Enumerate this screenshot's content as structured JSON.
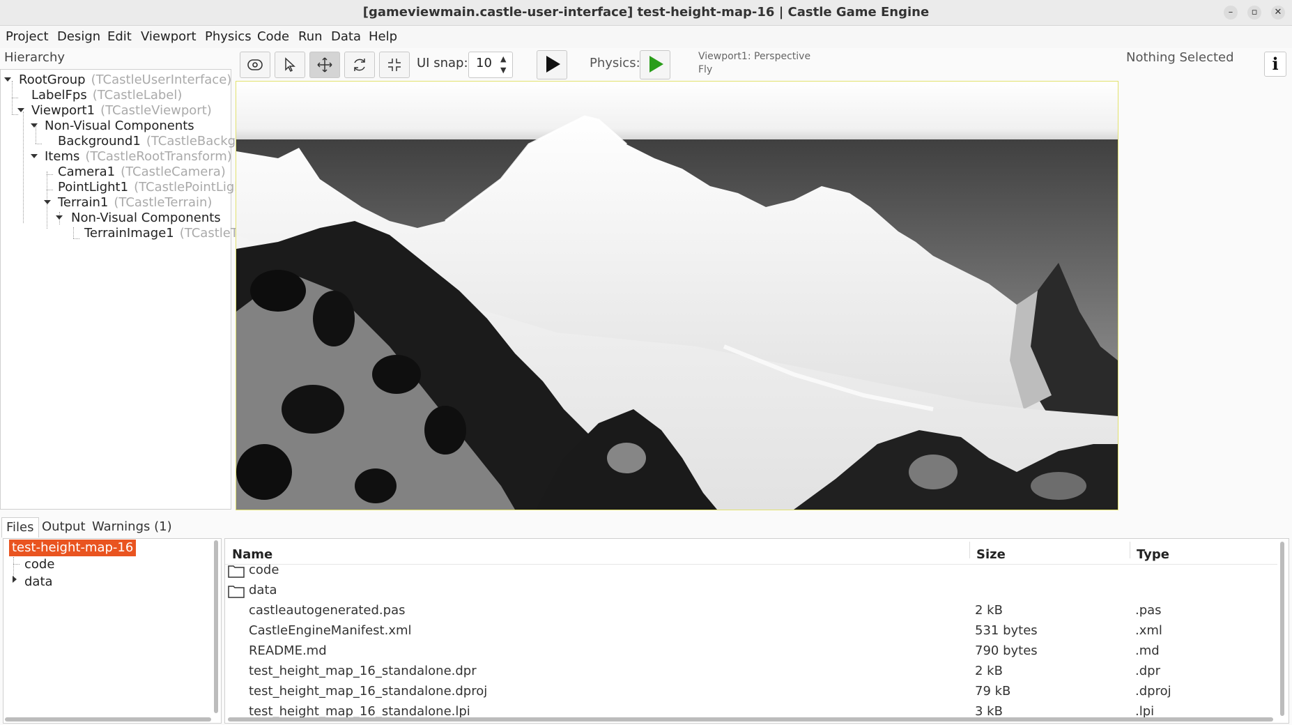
{
  "window": {
    "title": "[gameviewmain.castle-user-interface] test-height-map-16 | Castle Game Engine",
    "controls": [
      "minimize-icon",
      "maximize-icon",
      "close-icon"
    ]
  },
  "menu": [
    "Project",
    "Design",
    "Edit",
    "Viewport",
    "Physics",
    "Code",
    "Run",
    "Data",
    "Help"
  ],
  "hierarchy": {
    "label": "Hierarchy",
    "nodes": [
      {
        "name": "RootGroup",
        "class": "(TCastleUserInterface)"
      },
      {
        "name": "LabelFps",
        "class": "(TCastleLabel)"
      },
      {
        "name": "Viewport1",
        "class": "(TCastleViewport)"
      },
      {
        "name": "Non-Visual Components",
        "class": ""
      },
      {
        "name": "Background1",
        "class": "(TCastleBackgro"
      },
      {
        "name": "Items",
        "class": "(TCastleRootTransform)"
      },
      {
        "name": "Camera1",
        "class": "(TCastleCamera)"
      },
      {
        "name": "PointLight1",
        "class": "(TCastlePointLight"
      },
      {
        "name": "Terrain1",
        "class": "(TCastleTerrain)"
      },
      {
        "name": "Non-Visual Components",
        "class": ""
      },
      {
        "name": "TerrainImage1",
        "class": "(TCastleTe"
      }
    ]
  },
  "toolbar": {
    "tools": [
      "interact-icon",
      "select-icon",
      "translate-icon",
      "rotate-icon",
      "scale-icon"
    ],
    "active_tool": "translate-icon",
    "snap_label": "UI snap:",
    "snap_value": "10",
    "physics_label": "Physics:",
    "viewport_info_line1": "Viewport1: Perspective",
    "viewport_info_line2": "Fly"
  },
  "inspector": {
    "status": "Nothing Selected",
    "info_button": "i"
  },
  "bottom": {
    "tabs": [
      "Files",
      "Output",
      "Warnings (1)"
    ],
    "active_tab": "Files",
    "tree": {
      "root": "test-height-map-16",
      "children": [
        "code",
        "data"
      ]
    },
    "columns": {
      "name": "Name",
      "size": "Size",
      "type": "Type"
    },
    "files": [
      {
        "name": "code",
        "size": "",
        "type": "",
        "folder": true
      },
      {
        "name": "data",
        "size": "",
        "type": "",
        "folder": true
      },
      {
        "name": "castleautogenerated.pas",
        "size": "2 kB",
        "type": ".pas",
        "folder": false
      },
      {
        "name": "CastleEngineManifest.xml",
        "size": "531 bytes",
        "type": ".xml",
        "folder": false
      },
      {
        "name": "README.md",
        "size": "790 bytes",
        "type": ".md",
        "folder": false
      },
      {
        "name": "test_height_map_16_standalone.dpr",
        "size": "2 kB",
        "type": ".dpr",
        "folder": false
      },
      {
        "name": "test_height_map_16_standalone.dproj",
        "size": "79 kB",
        "type": ".dproj",
        "folder": false
      },
      {
        "name": "test_height_map_16_standalone.lpi",
        "size": "3 kB",
        "type": ".lpi",
        "folder": false
      }
    ]
  },
  "colors": {
    "accent_selected": "#e95420",
    "play_green": "#2a9d1a",
    "viewport_border": "#e2e26e"
  }
}
